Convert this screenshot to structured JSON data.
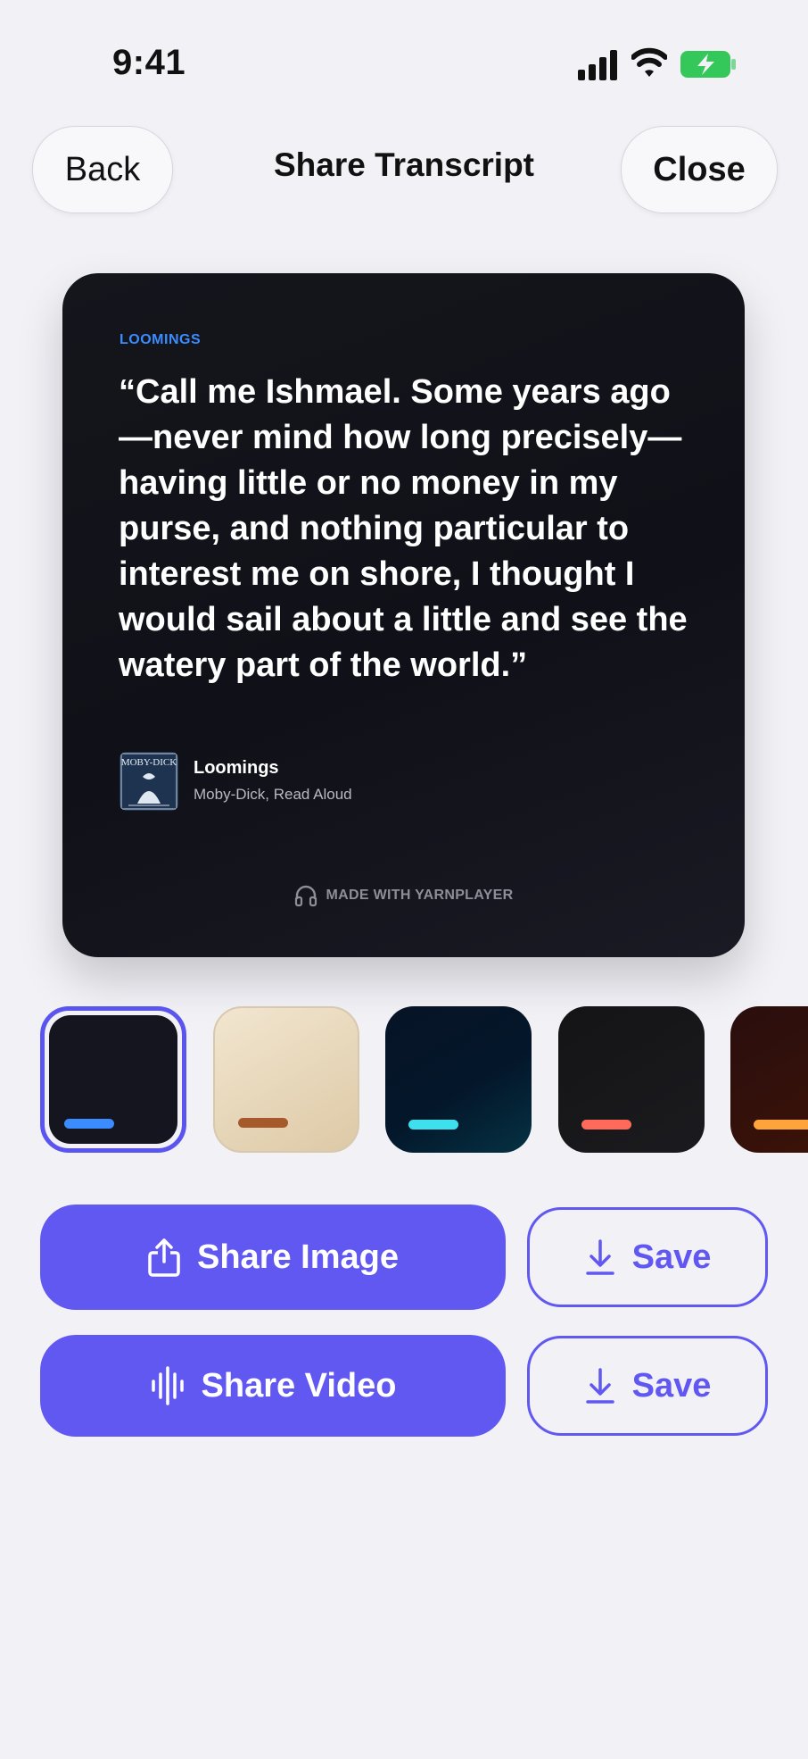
{
  "status_bar": {
    "time": "9:41"
  },
  "header": {
    "back_label": "Back",
    "title": "Share Transcript",
    "close_label": "Close"
  },
  "card": {
    "tag": "LOOMINGS",
    "quote": "“Call me Ishmael. Some years ago—never mind how long precisely—having little or no money in my purse, and nothing particular to interest me on shore, I thought I would sail about a little and see the watery part of the world.”",
    "episode_title": "Loomings",
    "episode_subtitle": "Moby-Dick, Read Aloud",
    "artwork_text": "MOBY-DICK",
    "made_with": "MADE WITH YARNPLAYER"
  },
  "themes": [
    {
      "name": "dark",
      "accent": "#3b8cff",
      "selected": true
    },
    {
      "name": "paper",
      "accent": "#a65a2c",
      "selected": false
    },
    {
      "name": "ocean",
      "accent": "#3ee0ee",
      "selected": false
    },
    {
      "name": "black",
      "accent": "#ff6a5a",
      "selected": false
    },
    {
      "name": "ember",
      "accent": "#ffa43a",
      "selected": false
    }
  ],
  "actions": {
    "share_image_label": "Share Image",
    "save_image_label": "Save",
    "share_video_label": "Share Video",
    "save_video_label": "Save"
  },
  "colors": {
    "accent": "#6158f2",
    "background": "#f1f1f6"
  }
}
